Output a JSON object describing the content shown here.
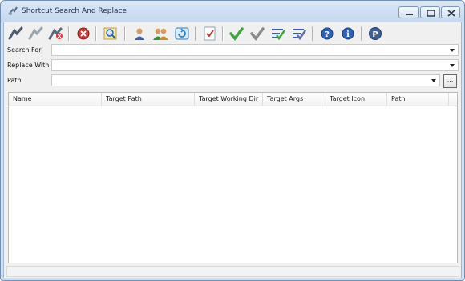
{
  "window": {
    "title": "Shortcut Search And Replace"
  },
  "toolbar": {
    "buttons": [
      {
        "icon": "run-icon",
        "tooltip": ""
      },
      {
        "icon": "run-disabled-icon",
        "tooltip": ""
      },
      {
        "icon": "stop-search-icon",
        "tooltip": ""
      },
      {
        "icon": "cancel-icon",
        "tooltip": ""
      },
      {
        "icon": "find-icon",
        "tooltip": ""
      },
      {
        "icon": "user-icon",
        "tooltip": ""
      },
      {
        "icon": "users-icon",
        "tooltip": ""
      },
      {
        "icon": "refresh-icon",
        "tooltip": ""
      },
      {
        "icon": "checklist-icon",
        "tooltip": ""
      },
      {
        "icon": "check-green-icon",
        "tooltip": ""
      },
      {
        "icon": "check-gray-icon",
        "tooltip": ""
      },
      {
        "icon": "check-lines-green-icon",
        "tooltip": ""
      },
      {
        "icon": "check-lines-blue-icon",
        "tooltip": ""
      },
      {
        "icon": "help-icon",
        "tooltip": ""
      },
      {
        "icon": "info-icon",
        "tooltip": ""
      },
      {
        "icon": "app-logo-icon",
        "tooltip": ""
      }
    ]
  },
  "form": {
    "search_for": {
      "label": "Search For",
      "value": ""
    },
    "replace_with": {
      "label": "Replace With",
      "value": ""
    },
    "path": {
      "label": "Path",
      "value": "",
      "browse_label": "..."
    }
  },
  "list": {
    "columns": [
      "Name",
      "Target Path",
      "Target Working Dir",
      "Target Args",
      "Target Icon",
      "Path"
    ],
    "rows": []
  },
  "colors": {
    "titlebar": "#cfe0f3",
    "accent_green": "#3aa83a",
    "accent_blue": "#2b5fb0"
  }
}
